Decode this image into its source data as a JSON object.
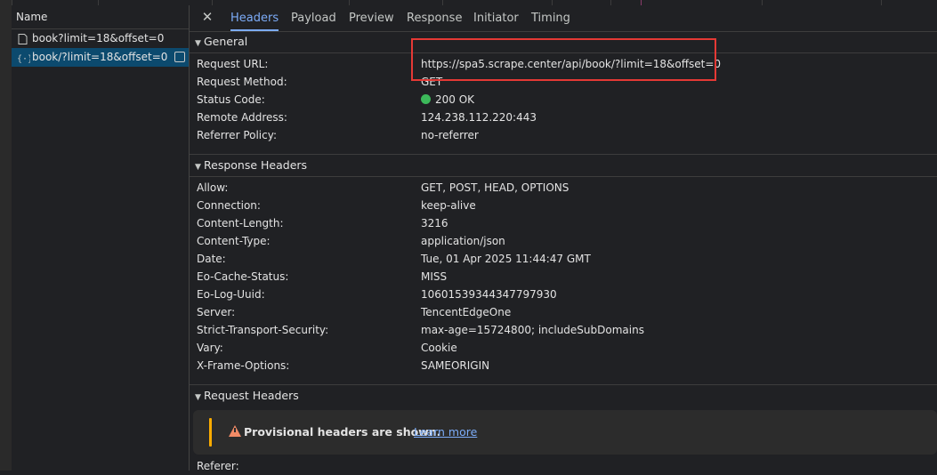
{
  "name_pane": {
    "header": "Name",
    "requests": [
      {
        "label": "book?limit=18&offset=0",
        "icon": "document-icon",
        "selected": false
      },
      {
        "label": "book/?limit=18&offset=0",
        "icon": "fetch-xhr-icon",
        "selected": true
      }
    ]
  },
  "tabs": [
    "Headers",
    "Payload",
    "Preview",
    "Response",
    "Initiator",
    "Timing"
  ],
  "active_tab": "Headers",
  "general": {
    "title": "General",
    "rows": [
      {
        "key": "Request URL:",
        "value": "https://spa5.scrape.center/api/book/?limit=18&offset=0"
      },
      {
        "key": "Request Method:",
        "value": "GET"
      },
      {
        "key": "Status Code:",
        "value": "200 OK"
      },
      {
        "key": "Remote Address:",
        "value": "124.238.112.220:443"
      },
      {
        "key": "Referrer Policy:",
        "value": "no-referrer"
      }
    ]
  },
  "response_headers": {
    "title": "Response Headers",
    "rows": [
      {
        "key": "Allow:",
        "value": "GET, POST, HEAD, OPTIONS"
      },
      {
        "key": "Connection:",
        "value": "keep-alive"
      },
      {
        "key": "Content-Length:",
        "value": "3216"
      },
      {
        "key": "Content-Type:",
        "value": "application/json"
      },
      {
        "key": "Date:",
        "value": "Tue, 01 Apr 2025 11:44:47 GMT"
      },
      {
        "key": "Eo-Cache-Status:",
        "value": "MISS"
      },
      {
        "key": "Eo-Log-Uuid:",
        "value": "10601539344347797930"
      },
      {
        "key": "Server:",
        "value": "TencentEdgeOne"
      },
      {
        "key": "Strict-Transport-Security:",
        "value": "max-age=15724800; includeSubDomains"
      },
      {
        "key": "Vary:",
        "value": "Cookie"
      },
      {
        "key": "X-Frame-Options:",
        "value": "SAMEORIGIN"
      }
    ]
  },
  "request_headers": {
    "title": "Request Headers",
    "notice": "Provisional headers are shown.",
    "learn_more": "Learn more",
    "rows": [
      {
        "key": "Referer:",
        "value": ""
      }
    ]
  },
  "colors": {
    "status_ok": "#3cb95a",
    "highlight_box": "#e53935",
    "active_tab": "#7cacf8",
    "warning": "#f28b66"
  }
}
